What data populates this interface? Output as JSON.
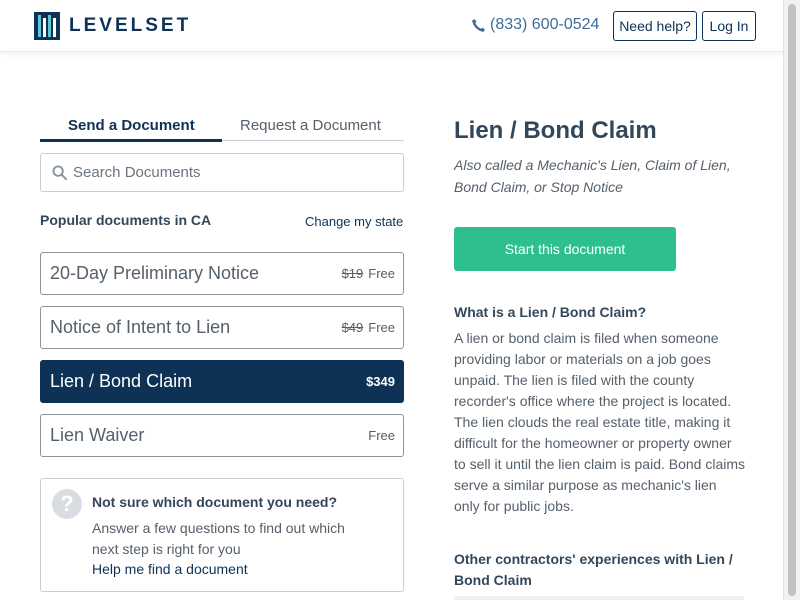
{
  "header": {
    "brand": "LEVELSET",
    "phone": "(833) 600-0524",
    "help_label": "Need help?",
    "login_label": "Log In"
  },
  "tabs": [
    {
      "label": "Send a Document",
      "active": true
    },
    {
      "label": "Request a Document",
      "active": false
    }
  ],
  "search": {
    "placeholder": "Search Documents",
    "value": ""
  },
  "popular": {
    "heading": "Popular documents in CA",
    "change_state": "Change my state"
  },
  "documents": [
    {
      "name": "20-Day Preliminary Notice",
      "old_price": "$19",
      "price": "Free",
      "active": false
    },
    {
      "name": "Notice of Intent to Lien",
      "old_price": "$49",
      "price": "Free",
      "active": false
    },
    {
      "name": "Lien / Bond Claim",
      "old_price": "",
      "price": "$349",
      "active": true
    },
    {
      "name": "Lien Waiver",
      "old_price": "",
      "price": "Free",
      "active": false
    }
  ],
  "help_box": {
    "title": "Not sure which document you need?",
    "body": "Answer a few questions to find out which next step is right for you",
    "link": "Help me find a document"
  },
  "detail": {
    "title": "Lien / Bond Claim",
    "subtitle": "Also called a Mechanic's Lien, Claim of Lien, Bond Claim, or Stop Notice",
    "start_label": "Start this document",
    "what_title": "What is a Lien / Bond Claim?",
    "what_body": "A lien or bond claim is filed when someone providing labor or materials on a job goes unpaid. The lien is filed with the county recorder's office where the project is located. The lien clouds the real estate title, making it difficult for the homeowner or property owner to sell it until the lien claim is paid. Bond claims serve a similar purpose as mechanic's lien only for public jobs.",
    "other_title": "Other contractors' experiences with Lien / Bond Claim"
  },
  "colors": {
    "navy": "#0d3256",
    "green": "#2ebf91",
    "text": "#33475b",
    "muted": "#55606b"
  }
}
